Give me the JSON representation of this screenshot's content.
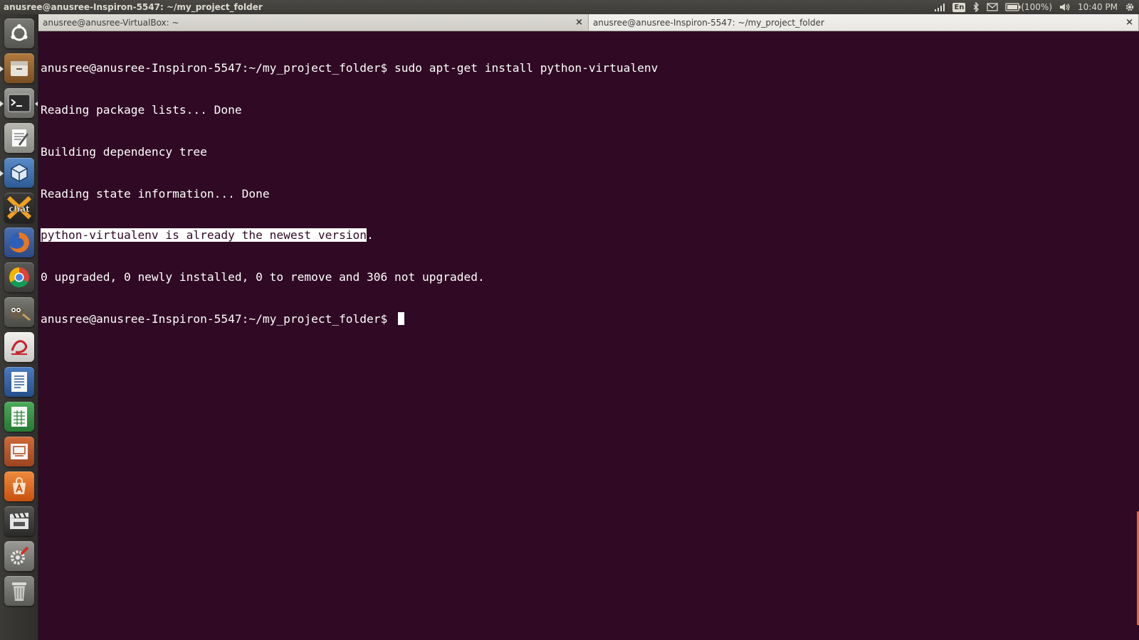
{
  "window": {
    "title": "anusree@anusree-Inspiron-5547: ~/my_project_folder"
  },
  "tray": {
    "keyboard": "En",
    "battery": "(100%)",
    "clock": "10:40 PM"
  },
  "tabs": [
    {
      "label": "anusree@anusree-VirtualBox: ~",
      "active": false
    },
    {
      "label": "anusree@anusree-Inspiron-5547: ~/my_project_folder",
      "active": true
    }
  ],
  "tab_close": "×",
  "terminal": {
    "prompt": "anusree@anusree-Inspiron-5547:~/my_project_folder$ ",
    "command": "sudo apt-get install python-virtualenv",
    "output": [
      "Reading package lists... Done",
      "Building dependency tree",
      "Reading state information... Done"
    ],
    "highlighted": "python-virtualenv is already the newest version",
    "highlighted_tail": ".",
    "summary": "0 upgraded, 0 newly installed, 0 to remove and 306 not upgraded."
  },
  "launcher": [
    {
      "name": "dash-home-icon",
      "color": "#6b6b68"
    },
    {
      "name": "files-icon",
      "color": "#8a5a2b"
    },
    {
      "name": "terminal-icon",
      "color": "#2c2c2c"
    },
    {
      "name": "text-editor-icon",
      "color": "#9c9c97"
    },
    {
      "name": "virtualbox-icon",
      "color": "#3e6fa8"
    },
    {
      "name": "xchat-icon",
      "color": "#2f2f2f"
    },
    {
      "name": "firefox-icon",
      "color": "#c35a1e"
    },
    {
      "name": "chrome-icon",
      "color": "#4a4a4a"
    },
    {
      "name": "gimp-icon",
      "color": "#5a5a55"
    },
    {
      "name": "pdf-viewer-icon",
      "color": "#d8d8d4"
    },
    {
      "name": "writer-icon",
      "color": "#2d5d9a"
    },
    {
      "name": "calc-icon",
      "color": "#2f8a3a"
    },
    {
      "name": "impress-icon",
      "color": "#b5532a"
    },
    {
      "name": "software-center-icon",
      "color": "#e26a1c"
    },
    {
      "name": "video-editor-icon",
      "color": "#3a3a3a"
    },
    {
      "name": "system-settings-icon",
      "color": "#7a7a76"
    },
    {
      "name": "trash-icon",
      "color": "#6a6a66"
    }
  ],
  "colors": {
    "terminal_bg": "#300a24",
    "terminal_fg": "#ffffff",
    "scroll_accent": "#e8663a"
  }
}
